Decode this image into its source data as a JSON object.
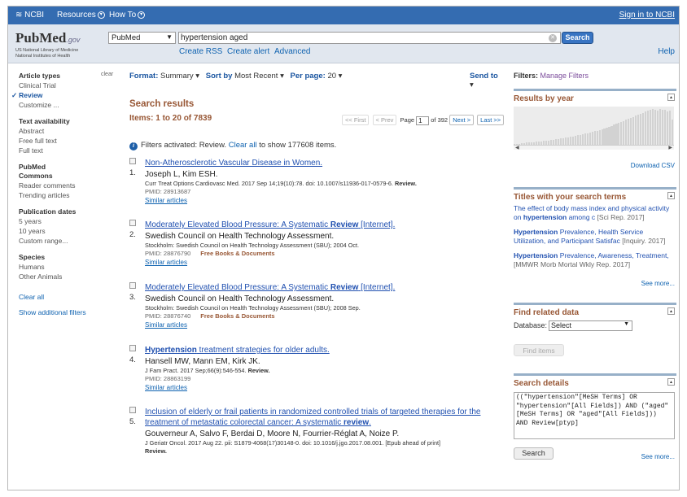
{
  "topbar": {
    "ncbi": "NCBI",
    "resources": "Resources",
    "howto": "How To",
    "signin": "Sign in to NCBI"
  },
  "header": {
    "logo_pub": "PubMed",
    "logo_gov": ".gov",
    "logo_sub1": "US National Library of Medicine",
    "logo_sub2": "National Institutes of Health",
    "db": "PubMed",
    "query": "hypertension aged",
    "search_btn": "Search",
    "create_rss": "Create RSS",
    "create_alert": "Create alert",
    "advanced": "Advanced",
    "help": "Help"
  },
  "sidebar": {
    "clear": "clear",
    "article_types": "Article types",
    "clinical_trial": "Clinical Trial",
    "review": "Review",
    "customize": "Customize ...",
    "text_availability": "Text availability",
    "abstract": "Abstract",
    "free_full_text": "Free full text",
    "full_text": "Full text",
    "pubmed_commons": "PubMed Commons",
    "reader_comments": "Reader comments",
    "trending": "Trending articles",
    "pub_dates": "Publication dates",
    "y5": "5 years",
    "y10": "10 years",
    "custom_range": "Custom range...",
    "species": "Species",
    "humans": "Humans",
    "other_animals": "Other Animals",
    "clear_all": "Clear all",
    "show_additional": "Show additional filters"
  },
  "toolbar": {
    "format_label": "Format:",
    "format_val": "Summary",
    "sort_label": "Sort by",
    "sort_val": "Most Recent",
    "perpage_label": "Per page:",
    "perpage_val": "20",
    "sendto": "Send to"
  },
  "results": {
    "heading": "Search results",
    "items": "Items: 1 to 20 of 7839",
    "first": "<< First",
    "prev": "< Prev",
    "page_label": "Page",
    "page": "1",
    "of": "of 392",
    "next": "Next >",
    "last": "Last >>",
    "filters_note": "Filters activated: Review.",
    "clear_all": "Clear all",
    "to_show": "to show 177608 items.",
    "list": [
      {
        "num": "1.",
        "title": "Non-Atherosclerotic Vascular Disease in Women.",
        "authors": "Joseph L, Kim ESH.",
        "cit": "Curr Treat Options Cardiovasc Med. 2017 Sep 14;19(10):78. doi: 10.1007/s11936-017-0579-6.",
        "cit_bold": "Review.",
        "pmid": "PMID: 28913687",
        "similar": "Similar articles"
      },
      {
        "num": "2.",
        "title_a": "Moderately Elevated Blood Pressure: A Systematic ",
        "title_b": "Review",
        "title_c": " [Internet].",
        "authors": "Swedish Council on Health Technology Assessment.",
        "cit": "Stockholm: Swedish Council on Health Technology Assessment (SBU); 2004 Oct.",
        "pmid": "PMID: 28876790",
        "free": "Free Books & Documents",
        "similar": "Similar articles"
      },
      {
        "num": "3.",
        "title_a": "Moderately Elevated Blood Pressure: A Systematic ",
        "title_b": "Review",
        "title_c": " [Internet].",
        "authors": "Swedish Council on Health Technology Assessment.",
        "cit": "Stockholm: Swedish Council on Health Technology Assessment (SBU); 2008 Sep.",
        "pmid": "PMID: 28876740",
        "free": "Free Books & Documents",
        "similar": "Similar articles"
      },
      {
        "num": "4.",
        "title_a": "Hypertension",
        "title_b": " treatment strategies for older adults.",
        "authors": "Hansell MW, Mann EM, Kirk JK.",
        "cit": "J Fam Pract. 2017 Sep;66(9):546-554.",
        "cit_bold": "Review.",
        "pmid": "PMID: 28863199",
        "similar": "Similar articles"
      },
      {
        "num": "5.",
        "title_a": "Inclusion of elderly or frail patients in randomized controlled trials of targeted therapies for the treatment of metastatic colorectal cancer: A systematic ",
        "title_b": "review",
        "title_c": ".",
        "authors": "Gouverneur A, Salvo F, Berdai D, Moore N, Fourrier-Réglat A, Noize P.",
        "cit": "J Geriatr Oncol. 2017 Aug 22. pii: S1879-4068(17)30148-0. doi: 10.1016/j.jgo.2017.08.001. [Epub ahead of print]",
        "cit_bold": "Review."
      }
    ]
  },
  "right": {
    "filters": "Filters:",
    "manage": "Manage Filters",
    "results_by_year": "Results by year",
    "download_csv": "Download CSV",
    "titles_heading": "Titles with your search terms",
    "t1a": "The effect of body mass index and physical activity on ",
    "t1b": "hypertension",
    "t1c": " among c",
    "t1g": "[Sci Rep. 2017]",
    "t2b": "Hypertension",
    "t2a": " Prevalence, Health Service Utilization, and Participant Satisfac",
    "t2g": "[Inquiry. 2017]",
    "t3b": "Hypertension",
    "t3a": " Prevalence, Awareness, Treatment, ",
    "t3g": "[MMWR Morb Mortal Wkly Rep. 2017]",
    "see_more": "See more...",
    "find_related": "Find related data",
    "database_label": "Database:",
    "database_val": "Select",
    "find_items": "Find items",
    "search_details": "Search details",
    "details_text": "((\"hypertension\"[MeSH Terms] OR \"hypertension\"[All Fields]) AND (\"aged\"[MeSH Terms] OR \"aged\"[All Fields])) AND Review[ptyp]",
    "search_btn": "Search",
    "see_more2": "See more..."
  },
  "chart_data": {
    "type": "bar",
    "x": [],
    "values": [
      2,
      3,
      3,
      4,
      4,
      5,
      5,
      6,
      6,
      7,
      7,
      8,
      9,
      9,
      10,
      11,
      12,
      13,
      14,
      15,
      16,
      17,
      18,
      19,
      20,
      22,
      23,
      24,
      25,
      27,
      28,
      30,
      31,
      33,
      34,
      36,
      38,
      40,
      42,
      44,
      46,
      48,
      50,
      52,
      54,
      57,
      60,
      62,
      65,
      67,
      70,
      72,
      75,
      77,
      80,
      82,
      84,
      86,
      85,
      83,
      86,
      84,
      85,
      80,
      82,
      60
    ],
    "title": "Results by year"
  }
}
